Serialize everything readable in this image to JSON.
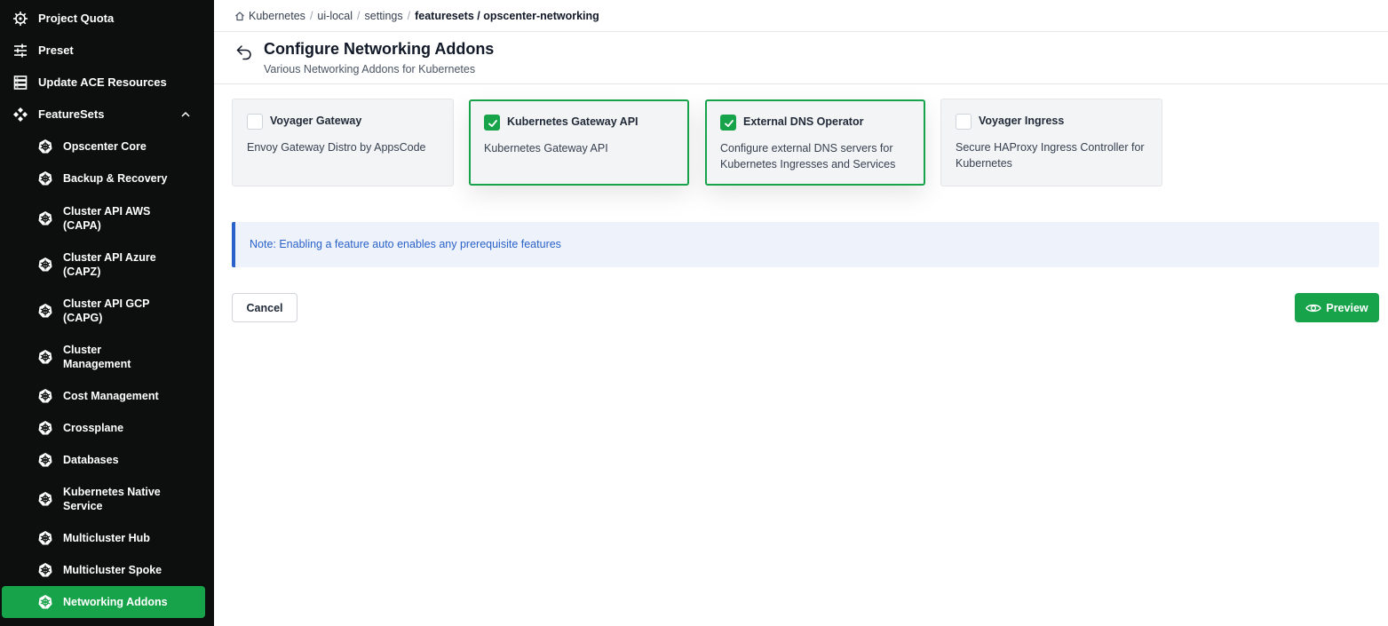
{
  "sidebar": {
    "top_items": [
      {
        "label": "Project Quota",
        "icon": "wheel-icon"
      },
      {
        "label": "Preset",
        "icon": "sliders-icon"
      },
      {
        "label": "Update ACE Resources",
        "icon": "server-icon"
      },
      {
        "label": "FeatureSets",
        "icon": "diamonds-icon",
        "expanded": true
      }
    ],
    "featuresets": [
      {
        "label": "Opscenter Core"
      },
      {
        "label": "Backup & Recovery"
      },
      {
        "label": "Cluster API AWS (CAPA)"
      },
      {
        "label": "Cluster API Azure (CAPZ)"
      },
      {
        "label": "Cluster API GCP (CAPG)"
      },
      {
        "label": "Cluster Management"
      },
      {
        "label": "Cost Management"
      },
      {
        "label": "Crossplane"
      },
      {
        "label": "Databases"
      },
      {
        "label": "Kubernetes Native Service"
      },
      {
        "label": "Multicluster Hub"
      },
      {
        "label": "Multicluster Spoke"
      },
      {
        "label": "Networking Addons",
        "active": true
      }
    ]
  },
  "breadcrumb": {
    "items": [
      "Kubernetes",
      "ui-local",
      "settings"
    ],
    "current": "featuresets / opscenter-networking"
  },
  "header": {
    "title": "Configure Networking Addons",
    "subtitle": "Various Networking Addons for Kubernetes"
  },
  "cards": [
    {
      "title": "Voyager Gateway",
      "description": "Envoy Gateway Distro by AppsCode",
      "checked": false
    },
    {
      "title": "Kubernetes Gateway API",
      "description": "Kubernetes Gateway API",
      "checked": true
    },
    {
      "title": "External DNS Operator",
      "description": "Configure external DNS servers for Kubernetes Ingresses and Services",
      "checked": true
    },
    {
      "title": "Voyager Ingress",
      "description": "Secure HAProxy Ingress Controller for Kubernetes",
      "checked": false
    }
  ],
  "note": "Note: Enabling a feature auto enables any prerequisite features",
  "actions": {
    "cancel_label": "Cancel",
    "preview_label": "Preview"
  },
  "colors": {
    "accent": "#17a34a",
    "sidebar_bg": "#0d0f0f",
    "note_text": "#2a62c9",
    "note_bg": "#eef3fb"
  }
}
